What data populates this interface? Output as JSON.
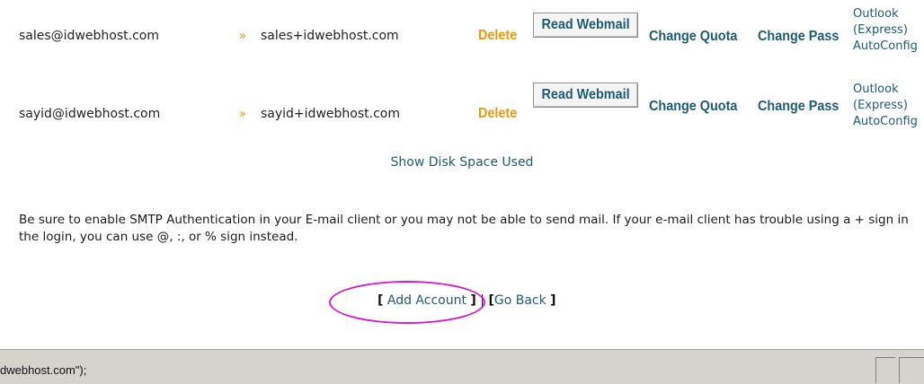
{
  "accounts": [
    {
      "email": "sales@idwebhost.com",
      "arrow": "»",
      "login": "sales+idwebhost.com",
      "delete_label": "Delete",
      "webmail_label": "Read Webmail",
      "quota_label": "Change Quota",
      "pass_label": "Change Pass",
      "autoconfig": [
        "Outlook",
        "(Express)",
        "AutoConfig"
      ]
    },
    {
      "email": "sayid@idwebhost.com",
      "arrow": "»",
      "login": "sayid+idwebhost.com",
      "delete_label": "Delete",
      "webmail_label": "Read Webmail",
      "quota_label": "Change Quota",
      "pass_label": "Change Pass",
      "autoconfig": [
        "Outlook",
        "(Express)",
        "AutoConfig"
      ]
    }
  ],
  "disk_space_link": "Show Disk Space Used",
  "notice": "Be sure to enable SMTP Authentication in your E-mail client or you may not be able to send mail. If your e-mail client has trouble using a + sign in the login, you can use @, :, or % sign instead.",
  "nav": {
    "open_bracket": "[",
    "add_account": "Add Account",
    "close_bracket": "]",
    "separator": "|",
    "go_back": "Go Back"
  },
  "annotation_color": "#d21ccf",
  "status_bar": {
    "text": "dwebhost.com\");"
  },
  "colors": {
    "delete": "#f0960a",
    "link": "#1f5a73",
    "arrow": "#f08c00"
  }
}
